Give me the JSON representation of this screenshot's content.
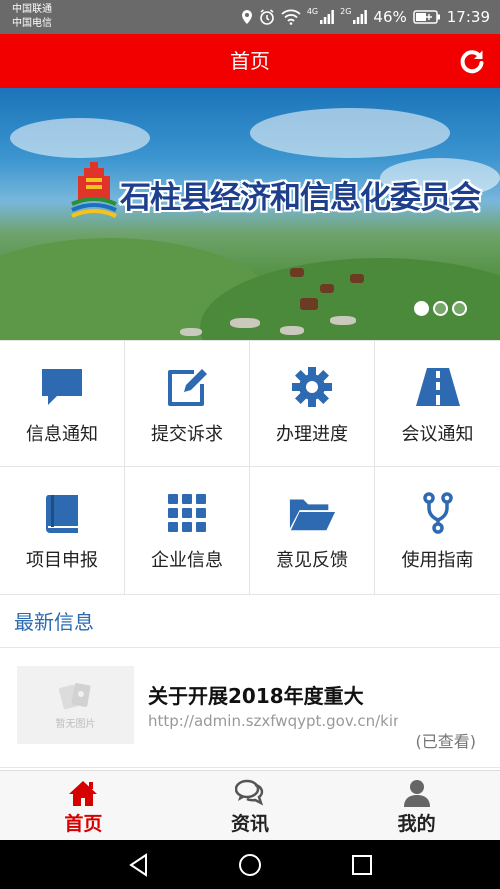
{
  "status_bar": {
    "carrier_1": "中国联通",
    "carrier_2": "中国电信",
    "network_1": "4G",
    "network_2": "2G",
    "battery": "46%",
    "time": "17:39"
  },
  "header": {
    "title": "首页",
    "accent_color": "#f20000"
  },
  "banner": {
    "text": "石柱县经济和信息化委员会",
    "slides": 3,
    "active_slide": 1
  },
  "menu": {
    "items": [
      {
        "label": "信息通知",
        "icon": "chat-bubble-icon"
      },
      {
        "label": "提交诉求",
        "icon": "edit-icon"
      },
      {
        "label": "办理进度",
        "icon": "gear-icon"
      },
      {
        "label": "会议通知",
        "icon": "road-icon"
      },
      {
        "label": "项目申报",
        "icon": "book-icon"
      },
      {
        "label": "企业信息",
        "icon": "grid-icon"
      },
      {
        "label": "意见反馈",
        "icon": "folder-open-icon"
      },
      {
        "label": "使用指南",
        "icon": "branch-icon"
      }
    ],
    "icon_color": "#2e6ab1"
  },
  "news": {
    "section_title": "最新信息",
    "items": [
      {
        "thumb_text": "暂无图片",
        "title": "关于开展2018年度重大",
        "url": "http://admin.szxfwqypt.gov.cn/kin",
        "status": "(已查看)"
      }
    ]
  },
  "tabs": [
    {
      "label": "首页",
      "icon": "home-icon",
      "active": true
    },
    {
      "label": "资讯",
      "icon": "chat-icon",
      "active": false
    },
    {
      "label": "我的",
      "icon": "user-icon",
      "active": false
    }
  ]
}
